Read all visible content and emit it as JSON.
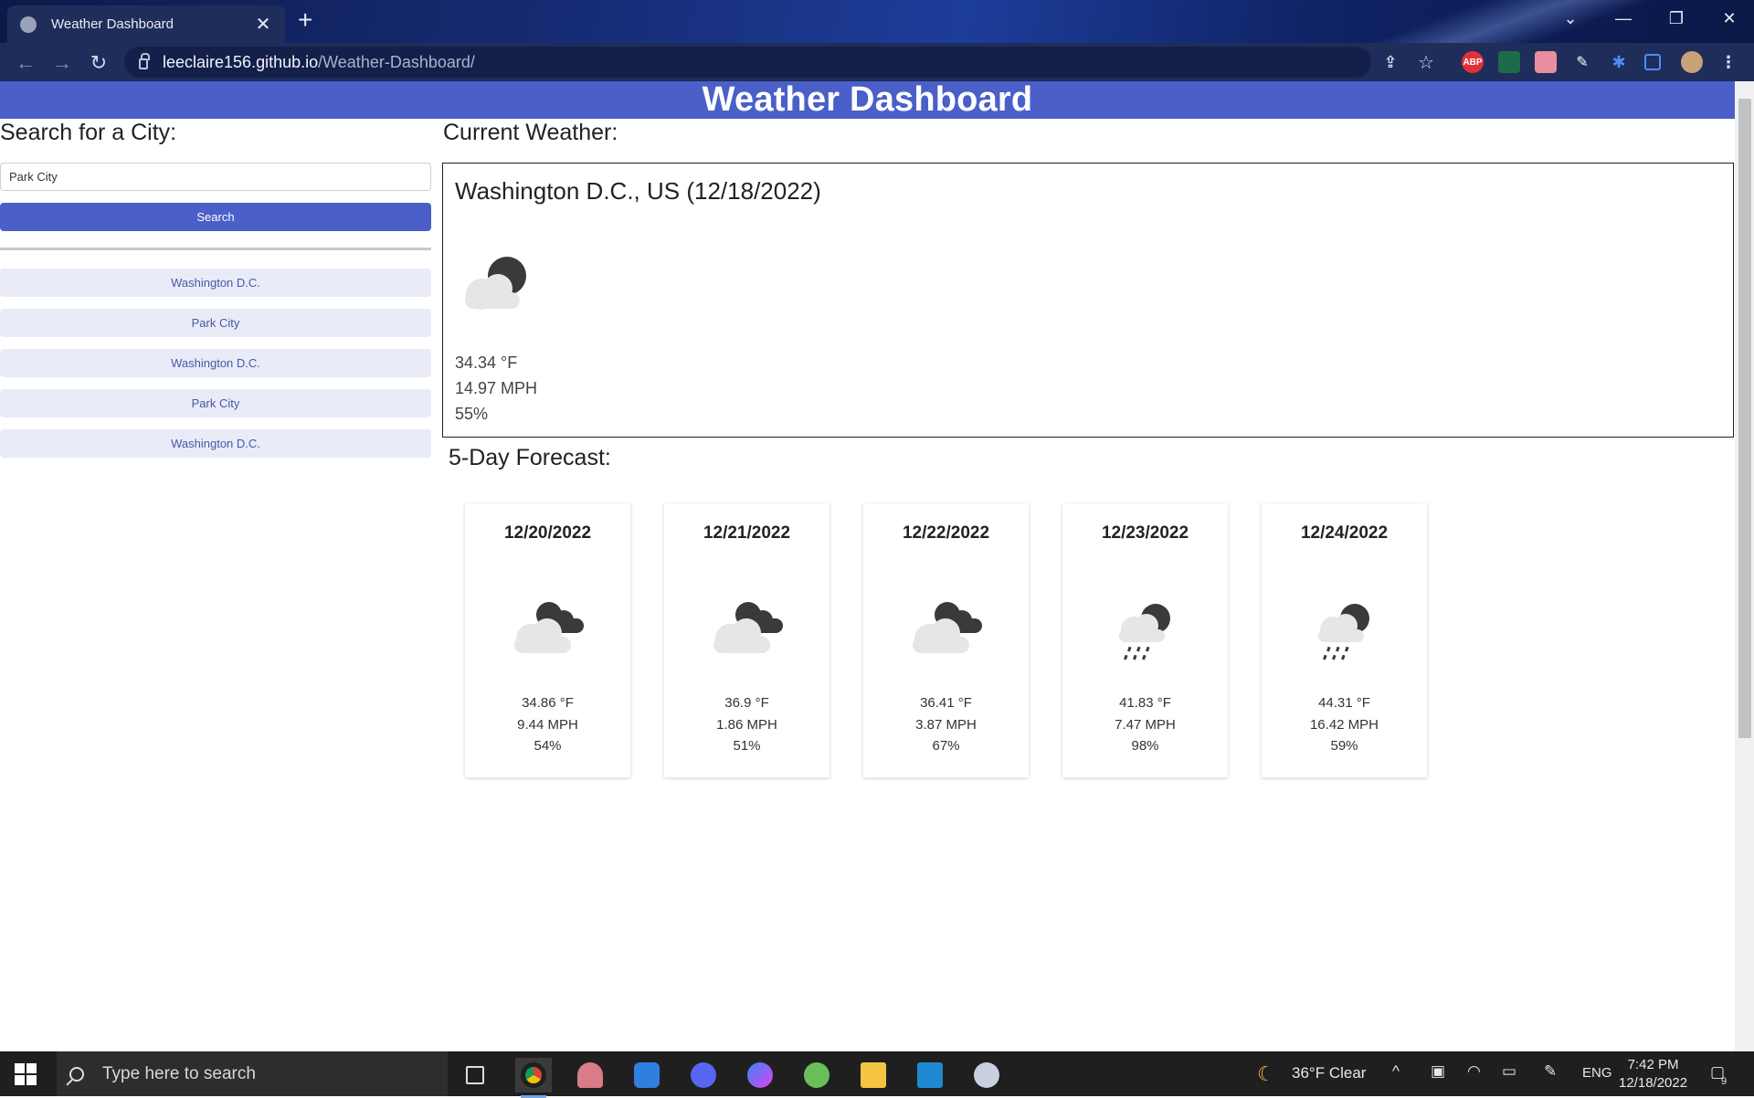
{
  "browser": {
    "tab_title": "Weather Dashboard",
    "tab_close": "✕",
    "new_tab": "+",
    "url_host": "leeclaire156.github.io",
    "url_path": "/Weather-Dashboard/",
    "extensions": [
      "ABP"
    ]
  },
  "header": {
    "title": "Weather Dashboard"
  },
  "sidebar": {
    "heading": "Search for a City:",
    "search_value": "Park City",
    "search_button": "Search",
    "history": [
      "Washington D.C.",
      "Park City",
      "Washington D.C.",
      "Park City",
      "Washington D.C."
    ]
  },
  "current": {
    "heading": "Current Weather:",
    "city": "Washington D.C., US (12/18/2022)",
    "icon": "night-partly-cloudy-icon",
    "temp": "34.34 °F",
    "wind": "14.97 MPH",
    "humidity": "55%"
  },
  "forecast": {
    "heading": "5-Day Forecast:",
    "days": [
      {
        "date": "12/20/2022",
        "icon": "night-broken-clouds-icon",
        "temp": "34.86 °F",
        "wind": "9.44 MPH",
        "humidity": "54%"
      },
      {
        "date": "12/21/2022",
        "icon": "night-broken-clouds-icon",
        "temp": "36.9 °F",
        "wind": "1.86 MPH",
        "humidity": "51%"
      },
      {
        "date": "12/22/2022",
        "icon": "night-broken-clouds-icon",
        "temp": "36.41 °F",
        "wind": "3.87 MPH",
        "humidity": "67%"
      },
      {
        "date": "12/23/2022",
        "icon": "night-rain-icon",
        "temp": "41.83 °F",
        "wind": "7.47 MPH",
        "humidity": "98%"
      },
      {
        "date": "12/24/2022",
        "icon": "night-rain-icon",
        "temp": "44.31 °F",
        "wind": "16.42 MPH",
        "humidity": "59%"
      }
    ]
  },
  "taskbar": {
    "search_placeholder": "Type here to search",
    "weather": "36°F  Clear",
    "language": "ENG",
    "time": "7:42 PM",
    "date": "12/18/2022",
    "notification_count": "9"
  }
}
